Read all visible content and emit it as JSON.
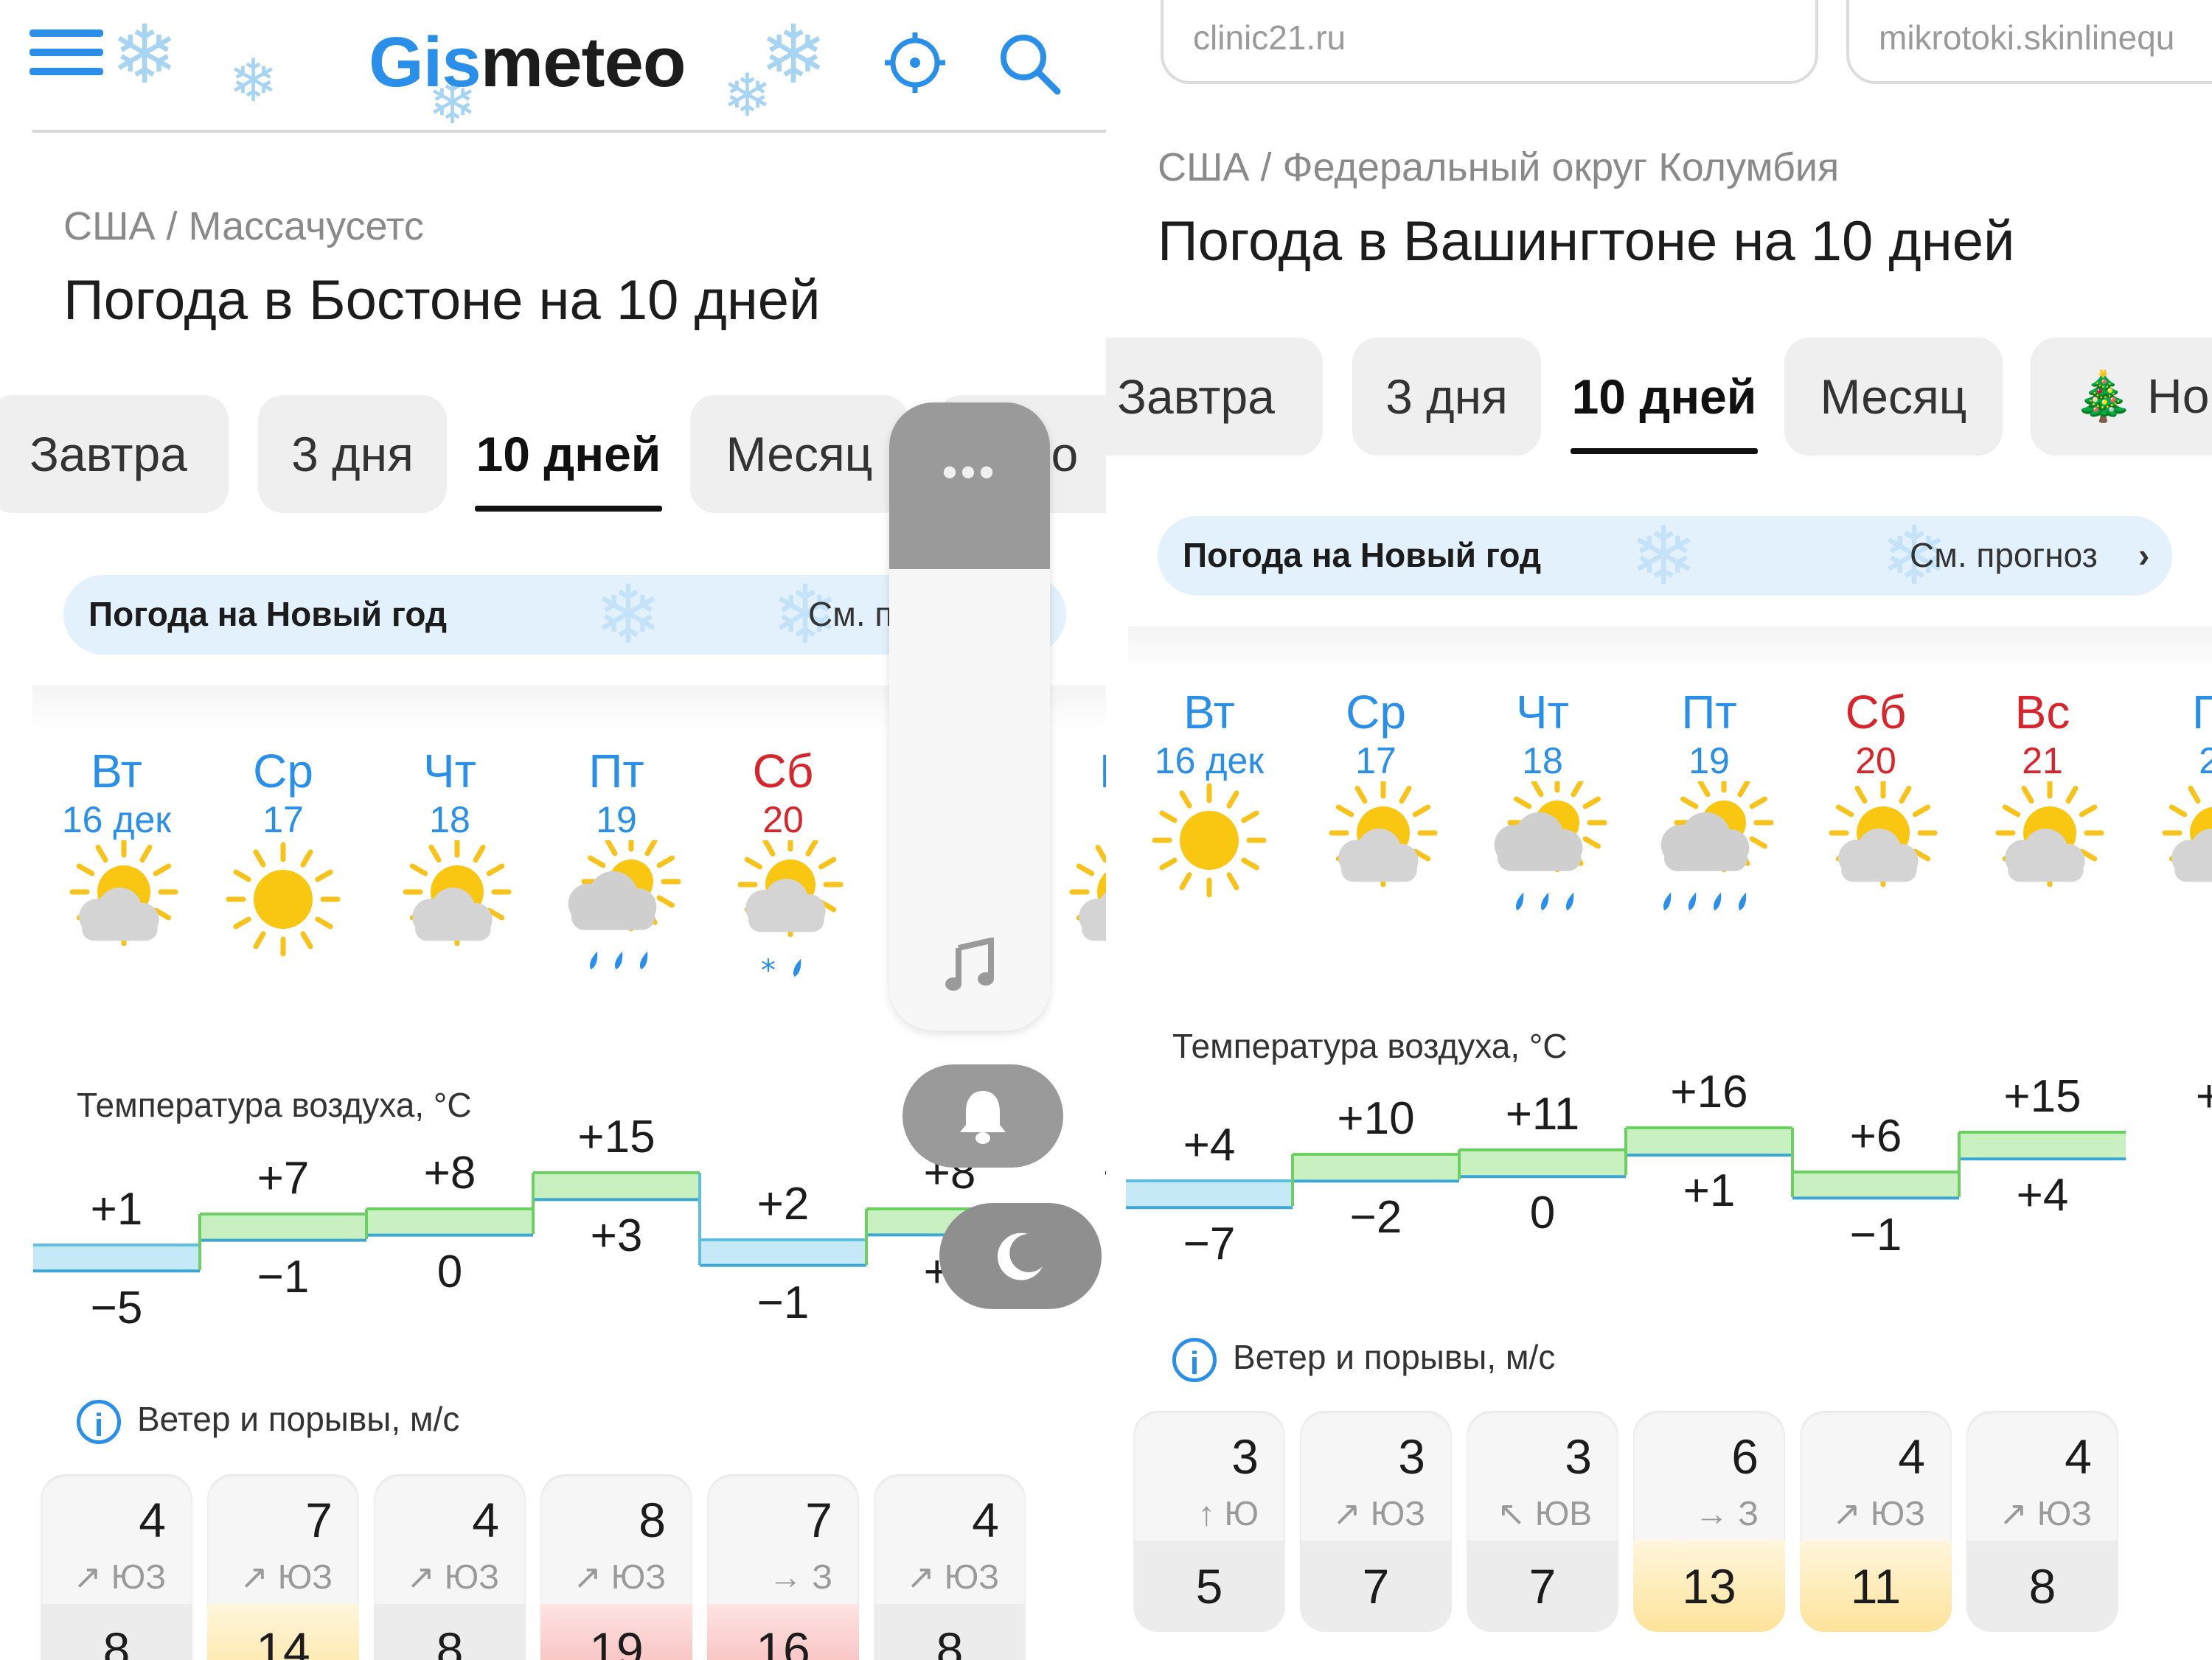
{
  "left": {
    "logo": {
      "part1": "Gis",
      "part2": "meteo"
    },
    "breadcrumb": "США / Массачусетс",
    "title": "Погода в Бостоне на 10 дней",
    "tabs": [
      "Завтра",
      "3 дня",
      "10 дней",
      "Месяц",
      "Но"
    ],
    "new_year": {
      "label": "Погода на Новый год",
      "link": "См. п"
    },
    "days": [
      {
        "name": "Вт",
        "date": "16 дек",
        "icon": "partly-cloudy-icon"
      },
      {
        "name": "Ср",
        "date": "17",
        "icon": "sun-icon"
      },
      {
        "name": "Чт",
        "date": "18",
        "icon": "partly-cloudy-icon"
      },
      {
        "name": "Пт",
        "date": "19",
        "icon": "cloud-rain-icon"
      },
      {
        "name": "Сб",
        "date": "20",
        "icon": "partly-cloudy-sleet-icon",
        "weekend": true
      },
      {
        "name": "Вс",
        "date": "21",
        "icon": "partly-cloudy-icon",
        "weekend": true
      },
      {
        "name": "П",
        "date": "2",
        "icon": "partly-cloudy-icon"
      }
    ],
    "temp_title": "Температура воздуха, °C",
    "tmax": [
      "+1",
      "+7",
      "+8",
      "+15",
      "+2",
      "+8",
      "+"
    ],
    "tmin": [
      "−5",
      "−1",
      "0",
      "+3",
      "−1",
      "+1",
      ""
    ],
    "tmax_values": [
      1,
      7,
      8,
      15,
      2,
      8
    ],
    "tmin_values": [
      -5,
      -1,
      0,
      3,
      -1,
      1
    ],
    "wind_title": "Ветер и порывы, м/с",
    "wind": [
      {
        "speed": "4",
        "dir": "↗ ЮЗ",
        "gust": "8",
        "tone": "n"
      },
      {
        "speed": "7",
        "dir": "↗ ЮЗ",
        "gust": "14",
        "tone": "y"
      },
      {
        "speed": "4",
        "dir": "↗ ЮЗ",
        "gust": "8",
        "tone": "n"
      },
      {
        "speed": "8",
        "dir": "↗ ЮЗ",
        "gust": "19",
        "tone": "r"
      },
      {
        "speed": "7",
        "dir": "→ З",
        "gust": "16",
        "tone": "r"
      },
      {
        "speed": "4",
        "dir": "↗ ЮЗ",
        "gust": "8",
        "tone": "n"
      }
    ]
  },
  "right": {
    "ads": [
      "clinic21.ru",
      "mikrotoki.skinlinequ"
    ],
    "breadcrumb": "США / Федеральный округ Колумбия",
    "title": "Погода в Вашингтоне на 10 дней",
    "tabs": [
      "Завтра",
      "3 дня",
      "10 дней",
      "Месяц",
      "🎄 Но"
    ],
    "new_year": {
      "label": "Погода на Новый год",
      "link": "См. прогноз"
    },
    "days": [
      {
        "name": "Вт",
        "date": "16 дек",
        "icon": "sun-icon"
      },
      {
        "name": "Ср",
        "date": "17",
        "icon": "partly-cloudy-icon"
      },
      {
        "name": "Чт",
        "date": "18",
        "icon": "cloud-rain-icon"
      },
      {
        "name": "Пт",
        "date": "19",
        "icon": "cloud-heavy-rain-icon"
      },
      {
        "name": "Сб",
        "date": "20",
        "icon": "partly-cloudy-icon",
        "weekend": true
      },
      {
        "name": "Вс",
        "date": "21",
        "icon": "partly-cloudy-icon",
        "weekend": true
      },
      {
        "name": "П",
        "date": "2",
        "icon": "partly-cloudy-icon"
      }
    ],
    "temp_title": "Температура воздуха, °C",
    "tmax": [
      "+4",
      "+10",
      "+11",
      "+16",
      "+6",
      "+15",
      "+"
    ],
    "tmin": [
      "−7",
      "−2",
      "0",
      "+1",
      "−1",
      "+4",
      ""
    ],
    "tmax_values": [
      4,
      10,
      11,
      16,
      6,
      15
    ],
    "tmin_values": [
      -7,
      -2,
      0,
      1,
      -1,
      4
    ],
    "wind_title": "Ветер и порывы, м/с",
    "wind": [
      {
        "speed": "3",
        "dir": "↑ Ю",
        "gust": "5",
        "tone": "n"
      },
      {
        "speed": "3",
        "dir": "↗ ЮЗ",
        "gust": "7",
        "tone": "n"
      },
      {
        "speed": "3",
        "dir": "↖ ЮВ",
        "gust": "7",
        "tone": "n"
      },
      {
        "speed": "6",
        "dir": "→ З",
        "gust": "13",
        "tone": "y"
      },
      {
        "speed": "4",
        "dir": "↗ ЮЗ",
        "gust": "11",
        "tone": "y"
      },
      {
        "speed": "4",
        "dir": "↗ ЮЗ",
        "gust": "8",
        "tone": "n"
      }
    ]
  },
  "overlay": {
    "menu_dots": "•••"
  }
}
